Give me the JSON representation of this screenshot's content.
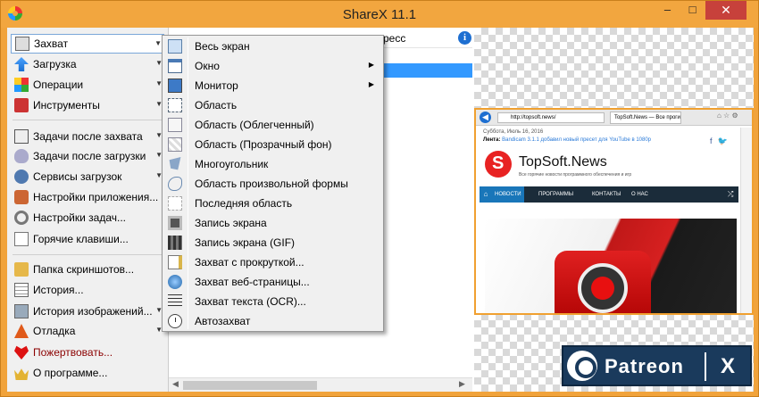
{
  "window": {
    "title": "ShareX 11.1",
    "minimize": "–",
    "maximize": "□",
    "close": "✕"
  },
  "leftmenu": {
    "items": [
      {
        "label": "Захват",
        "icon": "camera-icon",
        "has_arrow": true,
        "selected": true
      },
      {
        "label": "Загрузка",
        "icon": "upload-arrow-icon",
        "has_arrow": true
      },
      {
        "label": "Операции",
        "icon": "operations-grid-icon",
        "has_arrow": true
      },
      {
        "label": "Инструменты",
        "icon": "toolbox-icon",
        "has_arrow": true
      },
      {
        "label": "Задачи после захвата",
        "icon": "after-capture-icon",
        "has_arrow": true
      },
      {
        "label": "Задачи после загрузки",
        "icon": "after-upload-icon",
        "has_arrow": true
      },
      {
        "label": "Сервисы загрузок",
        "icon": "destinations-icon",
        "has_arrow": true
      },
      {
        "label": "Настройки приложения...",
        "icon": "app-settings-icon",
        "has_arrow": false
      },
      {
        "label": "Настройки задач...",
        "icon": "task-settings-gear-icon",
        "has_arrow": false
      },
      {
        "label": "Горячие клавиши...",
        "icon": "hotkey-icon",
        "has_arrow": false
      },
      {
        "label": "Папка скриншотов...",
        "icon": "screenshots-folder-icon",
        "has_arrow": false
      },
      {
        "label": "История...",
        "icon": "history-icon",
        "has_arrow": false
      },
      {
        "label": "История изображений...",
        "icon": "image-history-icon",
        "has_arrow": true
      },
      {
        "label": "Отладка",
        "icon": "debug-cone-icon",
        "has_arrow": true
      },
      {
        "label": "Пожертвовать...",
        "icon": "donate-heart-icon",
        "has_arrow": false
      },
      {
        "label": "О программе...",
        "icon": "about-crown-icon",
        "has_arrow": false
      }
    ]
  },
  "midpane": {
    "progress_header": "ресс",
    "info": "i"
  },
  "dropdown": {
    "items": [
      {
        "label": "Весь экран",
        "icon": "fullscreen-icon",
        "has_arrow": false
      },
      {
        "label": "Окно",
        "icon": "window-icon",
        "has_arrow": true
      },
      {
        "label": "Монитор",
        "icon": "monitor-icon",
        "has_arrow": true
      },
      {
        "label": "Область",
        "icon": "region-icon",
        "has_arrow": false
      },
      {
        "label": "Область (Облегченный)",
        "icon": "region-light-icon",
        "has_arrow": false
      },
      {
        "label": "Область (Прозрачный фон)",
        "icon": "region-transparent-icon",
        "has_arrow": false
      },
      {
        "label": "Многоугольник",
        "icon": "polygon-icon",
        "has_arrow": false
      },
      {
        "label": "Область произвольной формы",
        "icon": "freehand-region-icon",
        "has_arrow": false
      },
      {
        "label": "Последняя область",
        "icon": "last-region-icon",
        "has_arrow": false
      },
      {
        "label": "Запись экрана",
        "icon": "screen-record-icon",
        "has_arrow": false
      },
      {
        "label": "Запись экрана (GIF)",
        "icon": "gif-record-icon",
        "has_arrow": false
      },
      {
        "label": "Захват с прокруткой...",
        "icon": "scrolling-capture-icon",
        "has_arrow": false
      },
      {
        "label": "Захват веб-страницы...",
        "icon": "webpage-capture-icon",
        "has_arrow": false
      },
      {
        "label": "Захват текста (OCR)...",
        "icon": "ocr-text-icon",
        "has_arrow": false
      },
      {
        "label": "Автозахват",
        "icon": "autocapture-clock-icon",
        "has_arrow": false
      }
    ]
  },
  "preview": {
    "browser_url": "http://topsoft.news/",
    "browser_tab": "TopSoft.News — Все проги",
    "site_date": "Суббота, Июль 16, 2016",
    "site_news_label": "Лента:",
    "site_news_text": "Bandicam 3.1.1 добавил новый пресет для YouTube в 1080p",
    "site_title": "TopSoft.News",
    "site_subtitle": "Все горячие новости программного обеспечения и игр",
    "nav_items": [
      "НОВОСТИ",
      "ПРОГРАММЫ",
      "КОНТАКТЫ",
      "О НАС"
    ],
    "social_fb": "f",
    "social_tw": "🐦"
  },
  "patreon": {
    "text": "Patreon",
    "x": "X"
  }
}
